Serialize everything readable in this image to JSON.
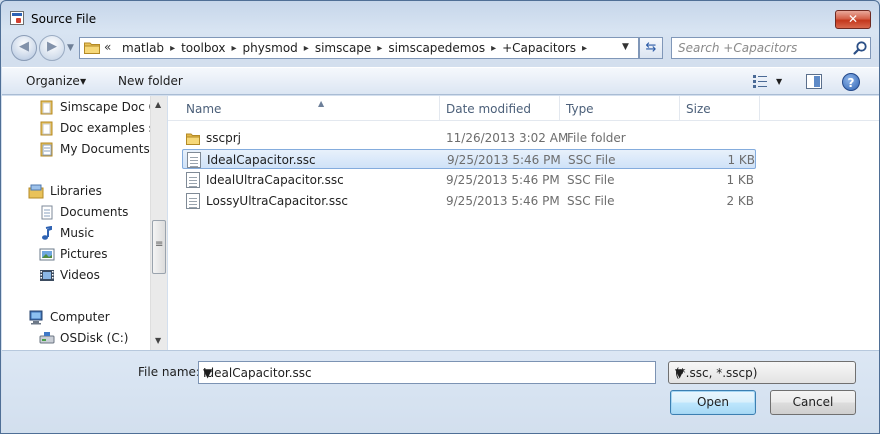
{
  "window": {
    "title": "Source File",
    "close_glyph": "✕"
  },
  "address": {
    "overflow_glyph": "«",
    "crumbs": [
      "matlab",
      "toolbox",
      "physmod",
      "simscape",
      "simscapedemos",
      "+Capacitors"
    ],
    "separator": "▸"
  },
  "search": {
    "placeholder": "Search +Capacitors"
  },
  "toolbar": {
    "organize_label": "Organize",
    "new_folder_label": "New folder",
    "help_glyph": "?"
  },
  "nav_pane": {
    "items": [
      {
        "label": "Simscape Doc Ce",
        "icon": "folder-icon"
      },
      {
        "label": "Doc examples sa",
        "icon": "folder-icon"
      },
      {
        "label": "My Documents",
        "icon": "documents-icon"
      },
      {
        "label": "Libraries",
        "icon": "libraries-icon"
      },
      {
        "label": "Documents",
        "icon": "documents-icon"
      },
      {
        "label": "Music",
        "icon": "music-icon"
      },
      {
        "label": "Pictures",
        "icon": "pictures-icon"
      },
      {
        "label": "Videos",
        "icon": "videos-icon"
      },
      {
        "label": "Computer",
        "icon": "computer-icon"
      },
      {
        "label": "OSDisk (C:)",
        "icon": "drive-icon"
      }
    ]
  },
  "file_list": {
    "columns": [
      "Name",
      "Date modified",
      "Type",
      "Size"
    ],
    "rows": [
      {
        "name": "sscprj",
        "date": "11/26/2013 3:02 AM",
        "type": "File folder",
        "size": "",
        "icon": "folder-icon"
      },
      {
        "name": "IdealCapacitor.ssc",
        "date": "9/25/2013 5:46 PM",
        "type": "SSC File",
        "size": "1 KB",
        "icon": "document-icon",
        "selected": true
      },
      {
        "name": "IdealUltraCapacitor.ssc",
        "date": "9/25/2013 5:46 PM",
        "type": "SSC File",
        "size": "1 KB",
        "icon": "document-icon"
      },
      {
        "name": "LossyUltraCapacitor.ssc",
        "date": "9/25/2013 5:46 PM",
        "type": "SSC File",
        "size": "2 KB",
        "icon": "document-icon"
      }
    ]
  },
  "bottom": {
    "file_name_label": "File name:",
    "file_name_value": "IdealCapacitor.ssc",
    "file_type_value": "(*.ssc, *.sscp)",
    "open_label": "Open",
    "cancel_label": "Cancel"
  }
}
